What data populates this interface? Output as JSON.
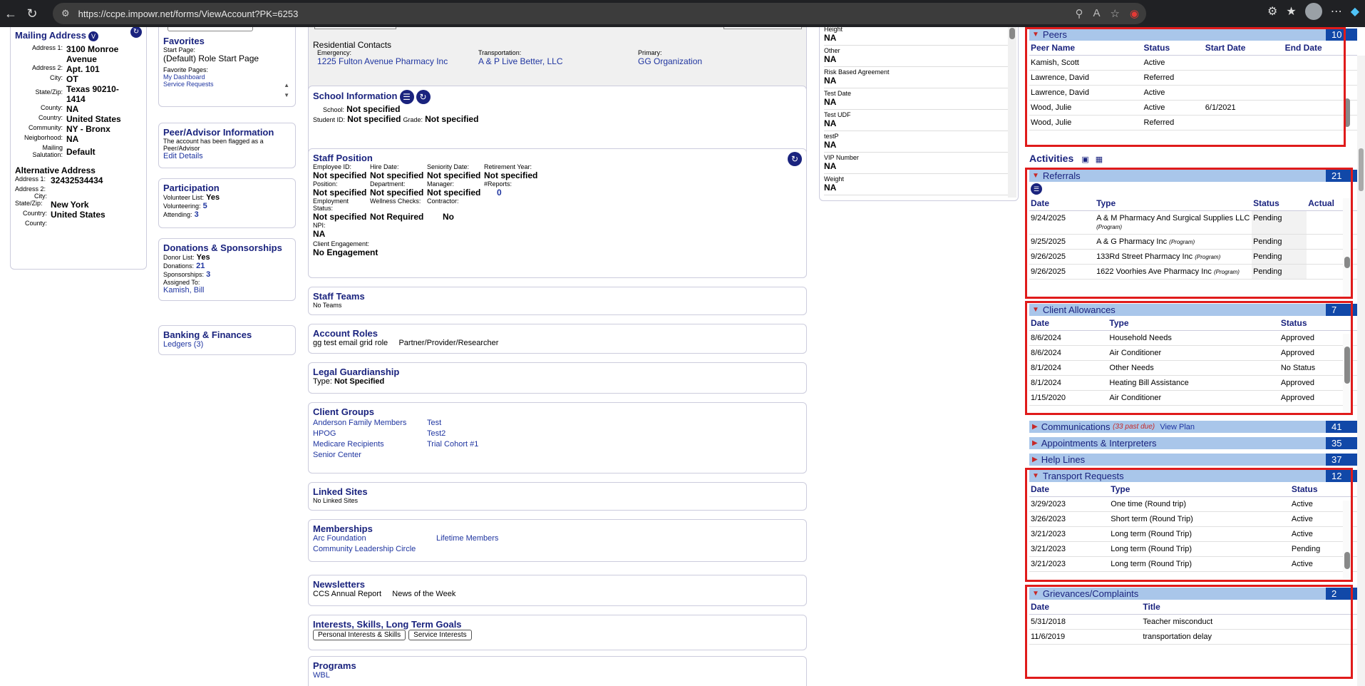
{
  "browser": {
    "url": "https://ccpe.impowr.net/forms/ViewAccount?PK=6253"
  },
  "mailing": {
    "title": "Mailing Address",
    "address1": "3100 Monroe Avenue",
    "address2": "Apt. 101",
    "city": "OT",
    "statezip": "Texas  90210-1414",
    "county": "NA",
    "country": "United States",
    "community": "NY - Bronx",
    "neighborhood": "NA",
    "salutation": "Default",
    "labels": {
      "address1": "Address 1:",
      "address2": "Address 2:",
      "city": "City:",
      "statezip": "State/Zip:",
      "county": "County:",
      "country": "Country:",
      "community": "Community:",
      "neighborhood": "Neigborhood:",
      "salutation": "Mailing Salutation:"
    }
  },
  "alt": {
    "title": "Alternative Address",
    "address1": "32432534434",
    "address2": "",
    "city": "",
    "statezip": "New York",
    "country": "United States",
    "county": ""
  },
  "favorites": {
    "title": "Favorites",
    "start_label": "Start Page:",
    "start_value": "(Default) Role Start Page",
    "pages_label": "Favorite Pages:",
    "pages": [
      "My Dashboard",
      "Service Requests"
    ]
  },
  "peeradv": {
    "title": "Peer/Advisor Information",
    "text": "The account has been flagged as a Peer/Advisor",
    "link": "Edit Details"
  },
  "participation": {
    "title": "Participation",
    "vlist_label": "Volunteer List:",
    "vlist": "Yes",
    "volunteering_label": "Volunteering:",
    "volunteering": "5",
    "attending_label": "Attending:",
    "attending": "3"
  },
  "donations": {
    "title": "Donations & Sponsorships",
    "donor_label": "Donor List:",
    "donor": "Yes",
    "donations_label": "Donations:",
    "donations": "21",
    "sponsorships_label": "Sponsorships:",
    "sponsorships": "3",
    "assigned_label": "Assigned To:",
    "assigned": "Kamish, Bill"
  },
  "banking": {
    "title": "Banking & Finances",
    "link": "Ledgers (3)"
  },
  "residential": {
    "title": "Residential Contacts",
    "emergency_label": "Emergency:",
    "emergency": "1225 Fulton Avenue Pharmacy Inc",
    "transport_label": "Transportation:",
    "transport": "A & P Live Better, LLC",
    "primary_label": "Primary:",
    "primary": "GG Organization"
  },
  "school": {
    "title": "School Information",
    "school_label": "School:",
    "school": "Not specified",
    "sid_label": "Student ID:",
    "sid": "Not specified",
    "grade_label": "Grade:",
    "grade": "Not specified"
  },
  "staff": {
    "title": "Staff Position",
    "fields": [
      {
        "l": "Employee ID:",
        "v": "Not specified"
      },
      {
        "l": "Hire Date:",
        "v": "Not specified"
      },
      {
        "l": "Seniority Date:",
        "v": "Not specified"
      },
      {
        "l": "Retirement Year:",
        "v": "Not specified"
      },
      {
        "l": "Position:",
        "v": "Not specified"
      },
      {
        "l": "Department:",
        "v": "Not specified"
      },
      {
        "l": "Manager:",
        "v": "Not specified"
      },
      {
        "l": "#Reports:",
        "v": "0"
      },
      {
        "l": "Employment Status:",
        "v": "Not specified"
      },
      {
        "l": "Wellness Checks:",
        "v": "Not Required"
      },
      {
        "l": "Contractor:",
        "v": "No"
      }
    ],
    "npi_label": "NPI:",
    "npi": "NA",
    "engage_label": "Client Engagement:",
    "engage": "No Engagement"
  },
  "staffteams": {
    "title": "Staff Teams",
    "text": "No Teams"
  },
  "roles": {
    "title": "Account Roles",
    "items": [
      "gg test email grid role",
      "Partner/Provider/Researcher"
    ]
  },
  "legal": {
    "title": "Legal Guardianship",
    "type_label": "Type:",
    "type": "Not Specified"
  },
  "groups": {
    "title": "Client Groups",
    "items": [
      "Anderson Family Members",
      "Test",
      "HPOG",
      "Test2",
      "Medicare Recipients",
      "Trial Cohort #1",
      "Senior Center"
    ]
  },
  "linked": {
    "title": "Linked Sites",
    "text": "No Linked Sites"
  },
  "memberships": {
    "title": "Memberships",
    "items": [
      "Arc Foundation",
      "Lifetime Members",
      "Community Leadership Circle"
    ]
  },
  "newsletters": {
    "title": "Newsletters",
    "items": [
      "CCS Annual Report",
      "News of the Week"
    ]
  },
  "interests": {
    "title": "Interests, Skills, Long Term Goals",
    "buttons": [
      "Personal Interests & Skills",
      "Service Interests"
    ]
  },
  "programs": {
    "title": "Programs",
    "items": [
      "WBL"
    ]
  },
  "udf": {
    "items": [
      {
        "l": "Height",
        "v": "NA"
      },
      {
        "l": "Other",
        "v": "NA"
      },
      {
        "l": "Risk Based Agreement",
        "v": "NA"
      },
      {
        "l": "Test Date",
        "v": "NA"
      },
      {
        "l": "Test UDF",
        "v": "NA"
      },
      {
        "l": "testP",
        "v": "NA"
      },
      {
        "l": "VIP Number",
        "v": "NA"
      },
      {
        "l": "Weight",
        "v": "NA"
      }
    ]
  },
  "peers": {
    "title": "Peers",
    "count": "10",
    "headers": [
      "Peer Name",
      "Status",
      "Start Date",
      "End Date"
    ],
    "rows": [
      [
        "Kamish, Scott",
        "Active",
        "",
        ""
      ],
      [
        "Lawrence, David",
        "Referred",
        "",
        ""
      ],
      [
        "Lawrence, David",
        "Active",
        "",
        ""
      ],
      [
        "Wood, Julie",
        "Active",
        "6/1/2021",
        ""
      ],
      [
        "Wood, Julie",
        "Referred",
        "",
        ""
      ]
    ]
  },
  "activities": {
    "title": "Activities"
  },
  "referrals": {
    "title": "Referrals",
    "count": "21",
    "headers": [
      "Date",
      "Type",
      "Status",
      "Actual"
    ],
    "rows": [
      [
        "9/24/2025",
        "A & M Pharmacy And Surgical Supplies LLC",
        "(Program)",
        "Pending"
      ],
      [
        "9/25/2025",
        "A & G Pharmacy Inc",
        "(Program)",
        "Pending"
      ],
      [
        "9/26/2025",
        "133Rd Street Pharmacy Inc",
        "(Program)",
        "Pending"
      ],
      [
        "9/26/2025",
        "1622 Voorhies Ave Pharmacy Inc",
        "(Program)",
        "Pending"
      ]
    ]
  },
  "allowances": {
    "title": "Client Allowances",
    "count": "7",
    "headers": [
      "Date",
      "Type",
      "Status"
    ],
    "rows": [
      [
        "8/6/2024",
        "Household Needs",
        "Approved"
      ],
      [
        "8/6/2024",
        "Air Conditioner",
        "Approved"
      ],
      [
        "8/1/2024",
        "Other Needs",
        "No Status"
      ],
      [
        "8/1/2024",
        "Heating Bill Assistance",
        "Approved"
      ],
      [
        "1/15/2020",
        "Air Conditioner",
        "Approved"
      ]
    ]
  },
  "communications": {
    "title": "Communications",
    "pastdue": "(33 past due)",
    "plan": "View Plan",
    "count": "41"
  },
  "appointments": {
    "title": "Appointments & Interpreters",
    "count": "35"
  },
  "helplines": {
    "title": "Help Lines",
    "count": "37"
  },
  "transport": {
    "title": "Transport Requests",
    "count": "12",
    "headers": [
      "Date",
      "Type",
      "Status"
    ],
    "rows": [
      [
        "3/29/2023",
        "One time (Round trip)",
        "Active"
      ],
      [
        "3/26/2023",
        "Short term (Round Trip)",
        "Active"
      ],
      [
        "3/21/2023",
        "Long term (Round Trip)",
        "Active"
      ],
      [
        "3/21/2023",
        "Long term (Round Trip)",
        "Pending"
      ],
      [
        "3/21/2023",
        "Long term (Round Trip)",
        "Active"
      ]
    ]
  },
  "grievances": {
    "title": "Grievances/Complaints",
    "count": "2",
    "headers": [
      "Date",
      "Title"
    ],
    "rows": [
      [
        "5/31/2018",
        "Teacher misconduct"
      ],
      [
        "11/6/2019",
        "transportation delay"
      ]
    ]
  }
}
